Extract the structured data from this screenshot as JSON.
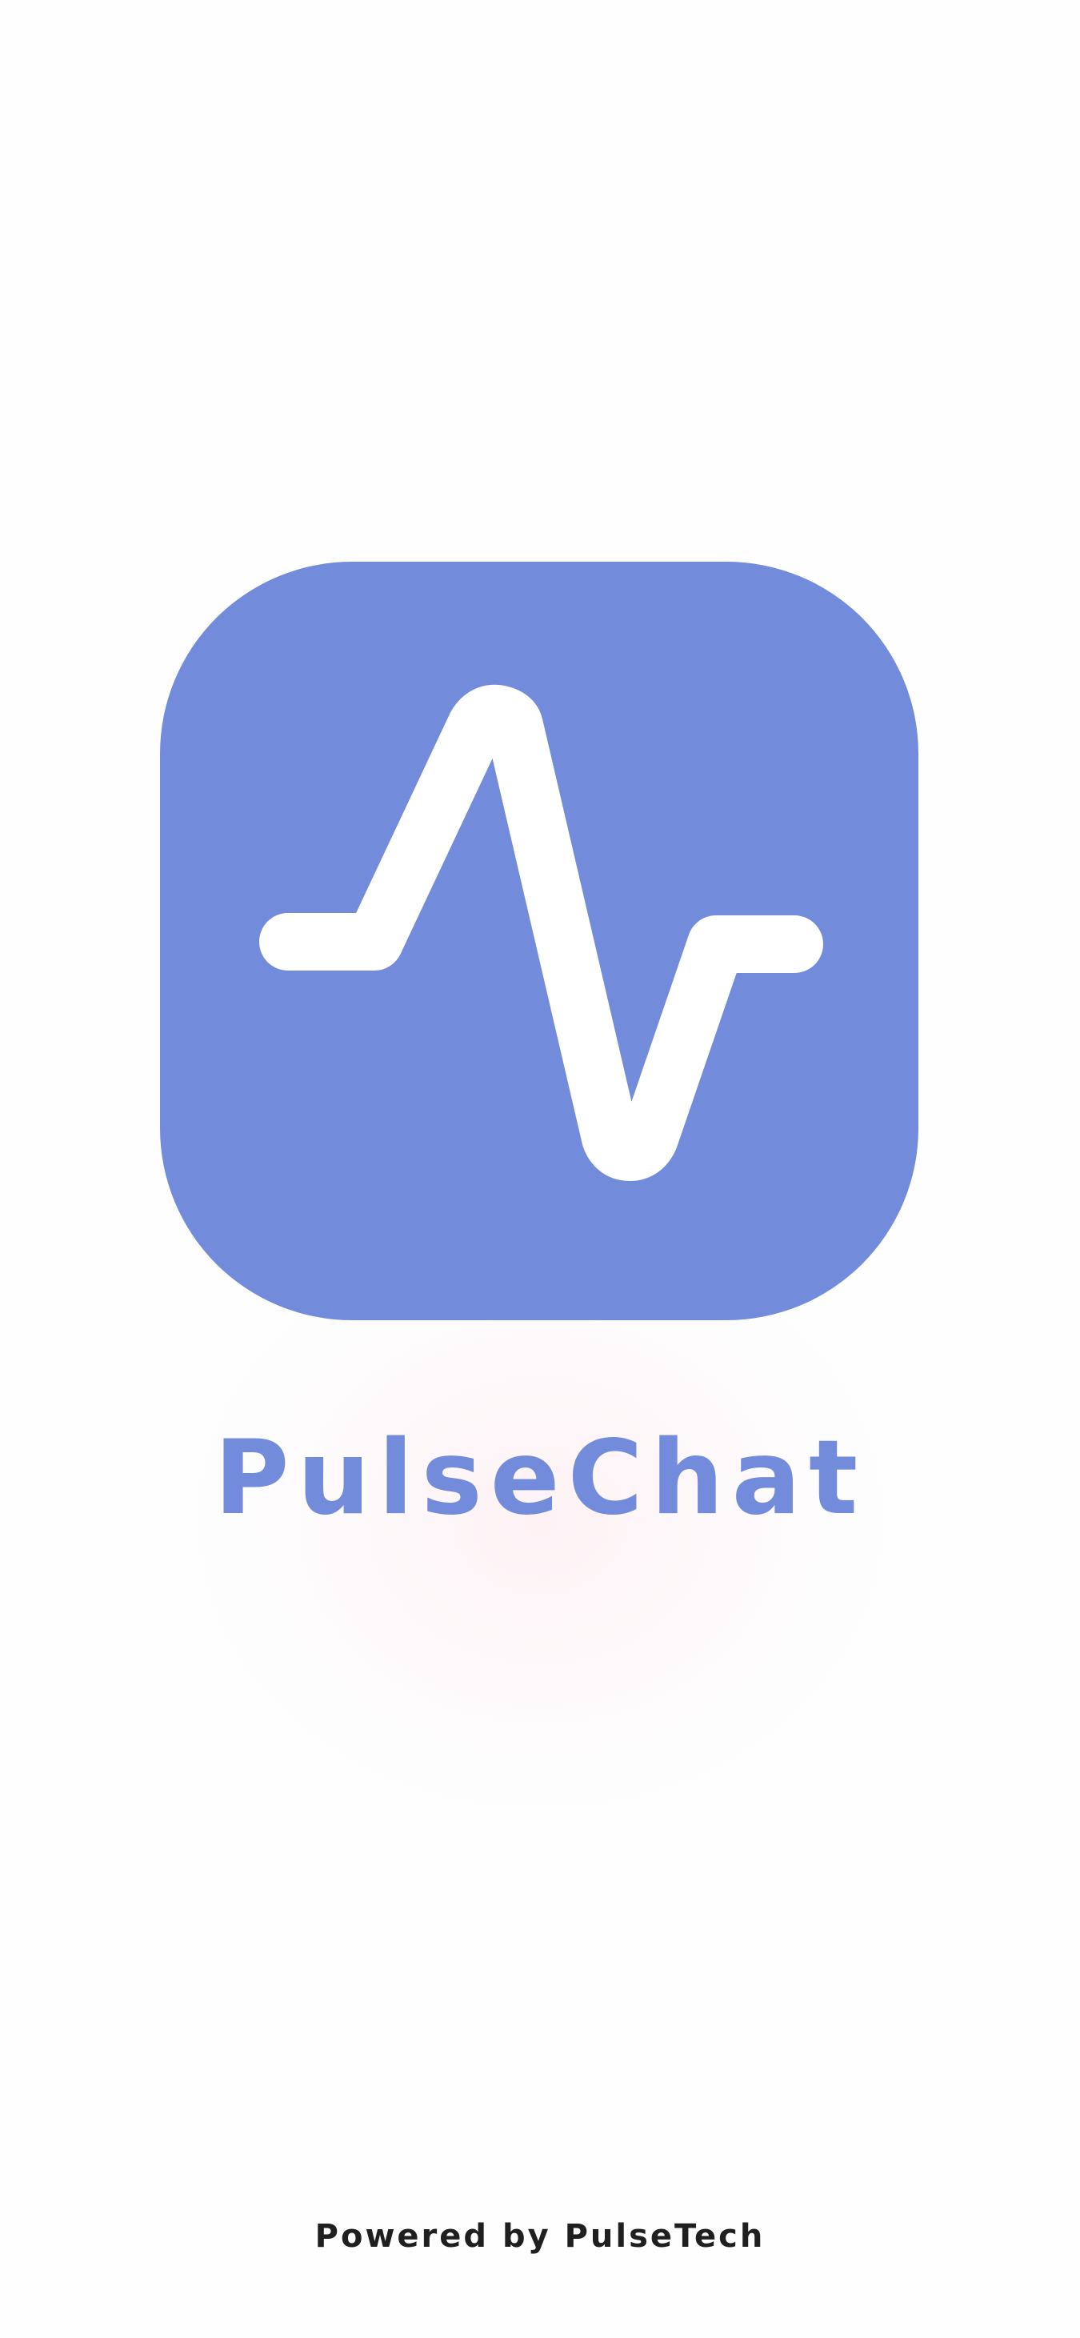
{
  "splash": {
    "app_icon": "pulse-waveform-icon",
    "app_name": "PulseChat",
    "powered_by": "Powered by PulseTech"
  },
  "colors": {
    "brand": "#738bdb",
    "background": "#fefefe",
    "footer_text": "#1f1f1f"
  }
}
